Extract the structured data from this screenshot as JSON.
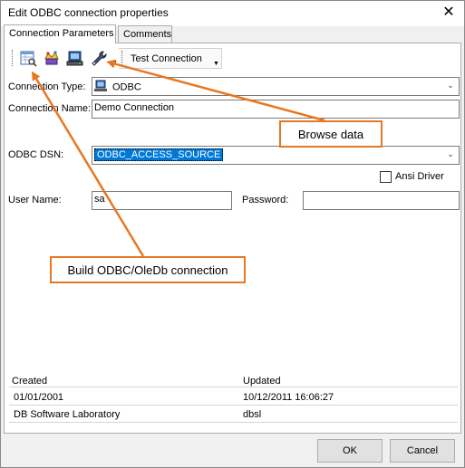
{
  "window": {
    "title": "Edit ODBC connection properties",
    "close_glyph": "✕"
  },
  "tabs": [
    {
      "label": "Connection Parameters",
      "active": true
    },
    {
      "label": "Comments",
      "active": false
    }
  ],
  "toolbar": {
    "buttons": [
      {
        "icon": "browse-data-icon"
      },
      {
        "icon": "build-connection-icon"
      },
      {
        "icon": "computer-icon"
      },
      {
        "icon": "wrench-icon"
      }
    ],
    "test_connection_label": "Test Connection"
  },
  "form": {
    "connection_type_label": "Connection Type:",
    "connection_type_value": "ODBC",
    "connection_name_label": "Connection Name:",
    "connection_name_value": "Demo Connection",
    "odbc_dsn_label": "ODBC DSN:",
    "odbc_dsn_value": "ODBC_ACCESS_SOURCE",
    "ansi_driver_label": "Ansi Driver",
    "ansi_driver_checked": false,
    "user_name_label": "User Name:",
    "user_name_value": "sa",
    "password_label": "Password:",
    "password_value": ""
  },
  "info": {
    "created_label": "Created",
    "updated_label": "Updated",
    "created_date": "01/01/2001",
    "updated_date": "10/12/2011 16:06:27",
    "created_by": "DB Software Laboratory",
    "updated_by": "dbsl"
  },
  "buttons": {
    "ok": "OK",
    "cancel": "Cancel"
  },
  "callouts": {
    "browse_data": "Browse data",
    "build_connection": "Build ODBC/OleDb connection"
  },
  "colors": {
    "accent_orange": "#e87722",
    "selection_blue": "#0078d7"
  }
}
